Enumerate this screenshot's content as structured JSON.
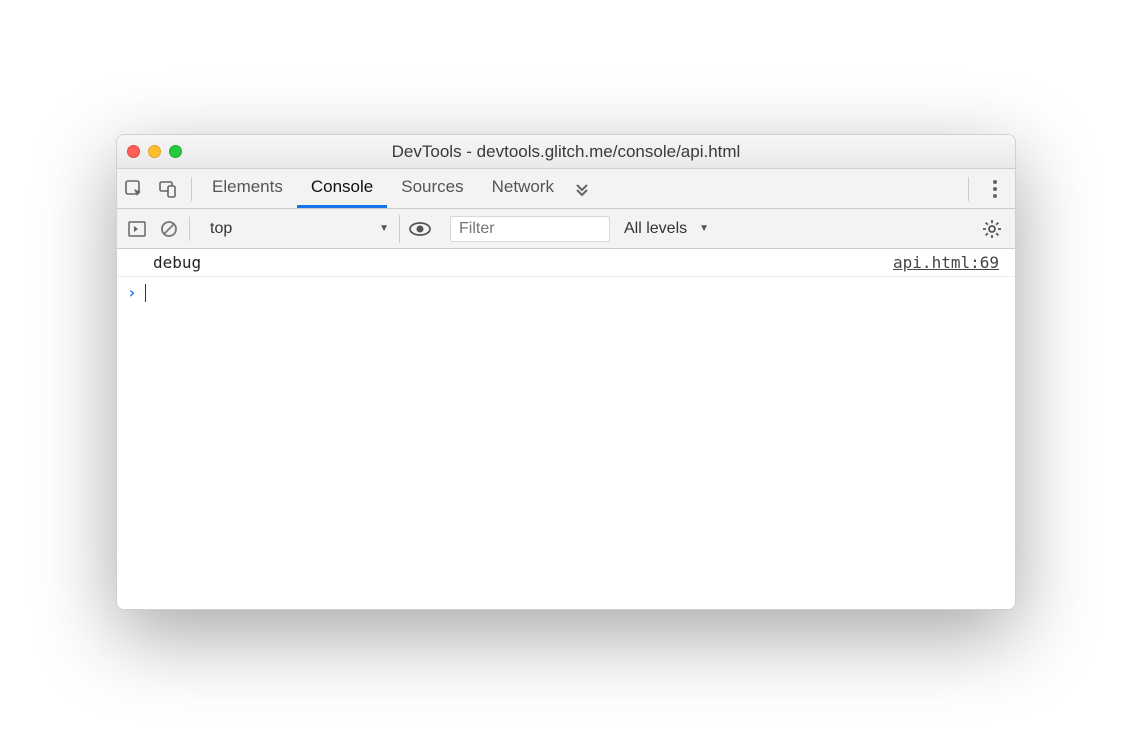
{
  "window": {
    "title": "DevTools - devtools.glitch.me/console/api.html"
  },
  "tabs": {
    "elements": "Elements",
    "console": "Console",
    "sources": "Sources",
    "network": "Network"
  },
  "subbar": {
    "context": "top",
    "filter_placeholder": "Filter",
    "levels_label": "All levels"
  },
  "console": {
    "log_message": "debug",
    "source_link": "api.html:69",
    "prompt_symbol": "›"
  }
}
